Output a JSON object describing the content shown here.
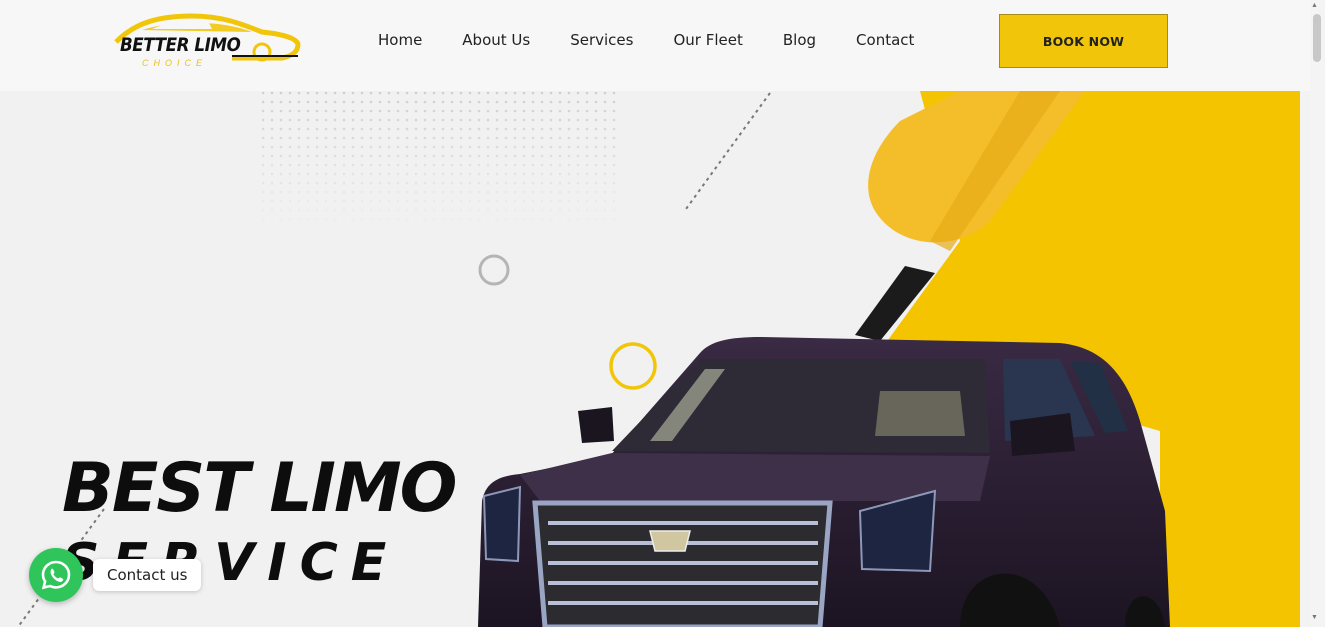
{
  "brand": {
    "name": "BETTER LIMO",
    "tagline": "CHOICE",
    "accent_color": "#f1c60a"
  },
  "nav": {
    "items": [
      {
        "label": "Home"
      },
      {
        "label": "About Us"
      },
      {
        "label": "Services"
      },
      {
        "label": "Our Fleet"
      },
      {
        "label": "Blog"
      },
      {
        "label": "Contact"
      }
    ]
  },
  "header": {
    "cta_label": "BOOK NOW"
  },
  "hero": {
    "title_line1": "BEST LIMO",
    "title_line2": "SERVICE"
  },
  "chat": {
    "icon": "whatsapp-icon",
    "label": "Contact us",
    "color": "#2fc55a"
  }
}
